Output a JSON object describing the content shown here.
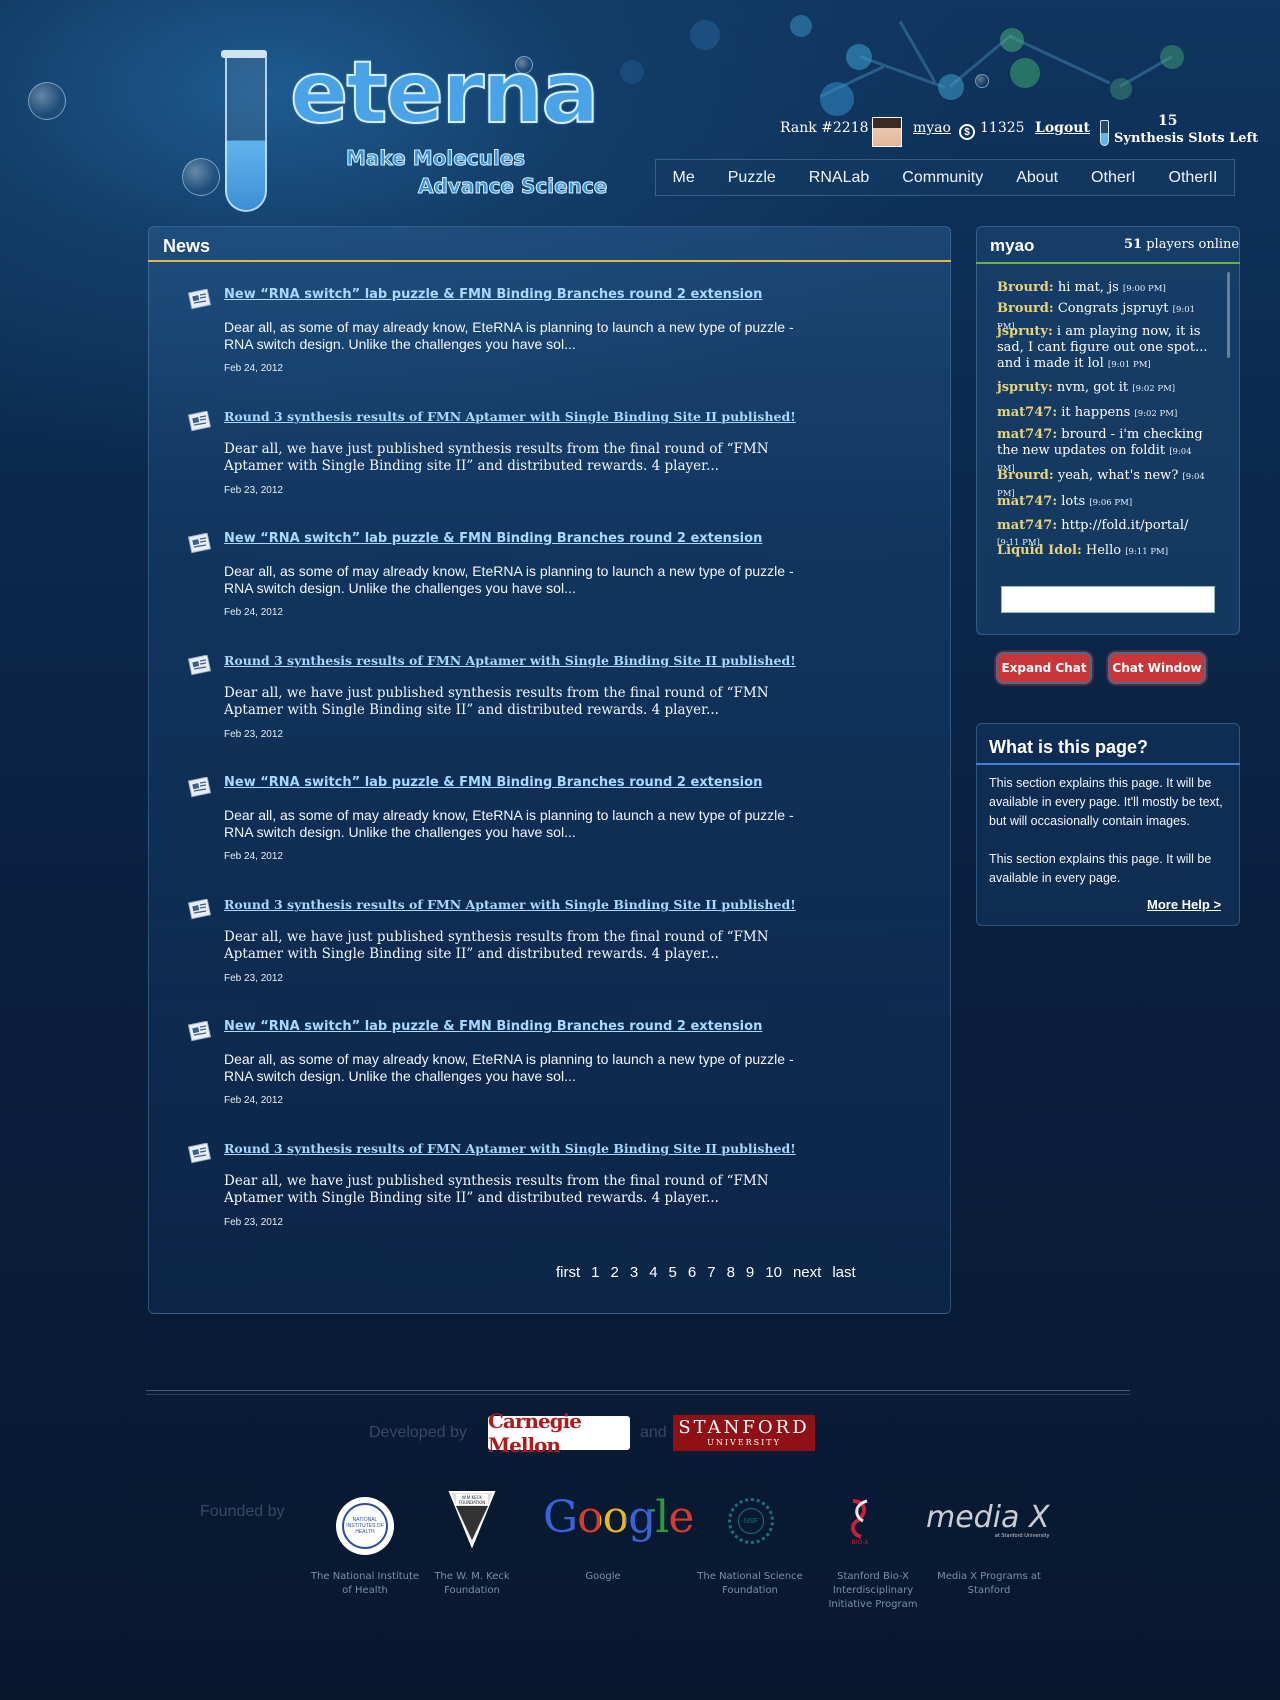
{
  "brand": {
    "logo_text": "eterna",
    "tagline_1": "Make Molecules",
    "tagline_2": "Advance Science"
  },
  "userbar": {
    "rank": "Rank #2218",
    "username": "myao",
    "coin_symbol": "$",
    "points": "11325",
    "logout": "Logout",
    "synthesis_count": "15",
    "synthesis_label": "Synthesis Slots Left"
  },
  "nav": {
    "items": [
      "Me",
      "Puzzle",
      "RNALab",
      "Community",
      "About",
      "OtherI",
      "OtherII"
    ]
  },
  "news": {
    "title": "News",
    "items": [
      {
        "title": "New “RNA switch” lab puzzle & FMN Binding Branches round 2 extension",
        "body": "Dear all, as some of may already know, EteRNA is planning to launch a new type of puzzle - RNA switch design. Unlike the challenges you have sol...",
        "date": "Feb 24, 2012"
      },
      {
        "title": "Round 3 synthesis results of FMN Aptamer with Single Binding Site II published!",
        "body": "Dear all, we have just published synthesis results from the final round of “FMN Aptamer with Single Binding site II” and distributed rewards. 4 player...",
        "date": "Feb 23, 2012"
      },
      {
        "title": "New “RNA switch” lab puzzle & FMN Binding Branches round 2 extension",
        "body": "Dear all, as some of may already know, EteRNA is planning to launch a new type of puzzle - RNA switch design. Unlike the challenges you have sol...",
        "date": "Feb 24, 2012"
      },
      {
        "title": "Round 3 synthesis results of FMN Aptamer with Single Binding Site II published!",
        "body": "Dear all, we have just published synthesis results from the final round of “FMN Aptamer with Single Binding site II” and distributed rewards. 4 player...",
        "date": "Feb 23, 2012"
      },
      {
        "title": "New “RNA switch” lab puzzle & FMN Binding Branches round 2 extension",
        "body": "Dear all, as some of may already know, EteRNA is planning to launch a new type of puzzle - RNA switch design. Unlike the challenges you have sol...",
        "date": "Feb 24, 2012"
      },
      {
        "title": "Round 3 synthesis results of FMN Aptamer with Single Binding Site II published!",
        "body": "Dear all, we have just published synthesis results from the final round of “FMN Aptamer with Single Binding site II” and distributed rewards. 4 player...",
        "date": "Feb 23, 2012"
      },
      {
        "title": "New “RNA switch” lab puzzle & FMN Binding Branches round 2 extension",
        "body": "Dear all, as some of may already know, EteRNA is planning to launch a new type of puzzle - RNA switch design. Unlike the challenges you have sol...",
        "date": "Feb 24, 2012"
      },
      {
        "title": "Round 3 synthesis results of FMN Aptamer with Single Binding Site II published!",
        "body": "Dear all, we have just published synthesis results from the final round of “FMN Aptamer with Single Binding site II” and distributed rewards. 4 player...",
        "date": "Feb 23, 2012"
      }
    ],
    "pager": [
      "first",
      "1",
      "2",
      "3",
      "4",
      "5",
      "6",
      "7",
      "8",
      "9",
      "10",
      "next",
      "last"
    ]
  },
  "chat": {
    "user": "myao",
    "online_count": "51",
    "online_label": "players online",
    "messages": [
      {
        "who": "Brourd:",
        "text": "hi mat, js",
        "time": "[9:00 PM]"
      },
      {
        "who": "Brourd:",
        "text": "Congrats jspruyt",
        "time": "[9:01 PM]"
      },
      {
        "who": "jspruty:",
        "text": "i am playing now, it is sad, I cant figure out one spot... and i made it lol",
        "time": "[9:01 PM]"
      },
      {
        "who": "jspruty:",
        "text": "nvm, got it",
        "time": "[9:02 PM]"
      },
      {
        "who": "mat747:",
        "text": "it happens",
        "time": "[9:02 PM]"
      },
      {
        "who": "mat747:",
        "text": "brourd - i'm checking the new updates on foldit",
        "time": "[9:04 PM]"
      },
      {
        "who": "Brourd:",
        "text": "yeah, what's new?",
        "time": "[9:04 PM]"
      },
      {
        "who": "mat747:",
        "text": "lots",
        "time": "[9:06 PM]"
      },
      {
        "who": "mat747:",
        "text": "http://fold.it/portal/",
        "time": "[9:11 PM]"
      },
      {
        "who": "Liquid Idol:",
        "text": "Hello",
        "time": "[9:11 PM]"
      }
    ],
    "expand_button": "Expand Chat",
    "window_button": "Chat Window"
  },
  "help": {
    "title": "What is this page?",
    "para1": "This section explains this page. It will be available in every page. It'll mostly be text, but will occasionally contain images.",
    "para2": "This section explains this page. It will be available in every page.",
    "more": "More Help >"
  },
  "footer": {
    "developed_by": "Developed by",
    "and": "and",
    "cmu": "Carnegie Mellon",
    "stanford_1": "STANFORD",
    "stanford_2": "UNIVERSITY",
    "founded_by": "Founded by",
    "nih_seal": "NATIONAL INSTITUTES OF HEALTH",
    "keck_badge": "W.M.KECK FOUNDATION",
    "google_logo": "Google",
    "nsf_seal": "NSF",
    "biox_logo": "BIO-X",
    "mediax_logo": "media X",
    "mediax_sub": "at Stanford University",
    "sponsors": [
      "The National Institute of Health",
      "The W. M. Keck Foundation",
      "Google",
      "The National Science Foundation",
      "Stanford Bio-X Interdisciplinary Initiative Program",
      "Media X Programs at Stanford"
    ]
  },
  "colors": {
    "news_rule": "#e0b84a",
    "chat_rule": "#6db04a",
    "help_rule": "#4a7fd0",
    "chat_name": "#e8d37a",
    "link": "#a8d8ff",
    "button": "#c9363a"
  }
}
